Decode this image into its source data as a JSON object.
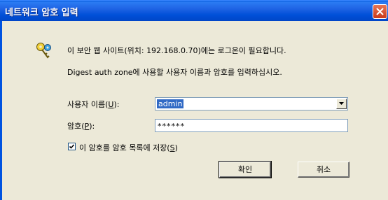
{
  "window": {
    "title": "네트워크 암호 입력"
  },
  "message": {
    "line1": "이 보안 웹 사이트(위치: 192.168.0.70)에는 로그온이 필요합니다.",
    "line2": "Digest auth zone에 사용할 사용자 이름과 암호를 입력하십시오."
  },
  "username": {
    "label_pre": "사용자 이름(",
    "hotkey": "U",
    "label_post": "):",
    "value": "admin"
  },
  "password": {
    "label_pre": "암호(",
    "hotkey": "P",
    "label_post": "):",
    "value": "******"
  },
  "save": {
    "label_pre": "이 암호를 암호 목록에 저장(",
    "hotkey": "S",
    "label_post": ")",
    "checked": true
  },
  "buttons": {
    "ok": "확인",
    "cancel": "취소"
  }
}
